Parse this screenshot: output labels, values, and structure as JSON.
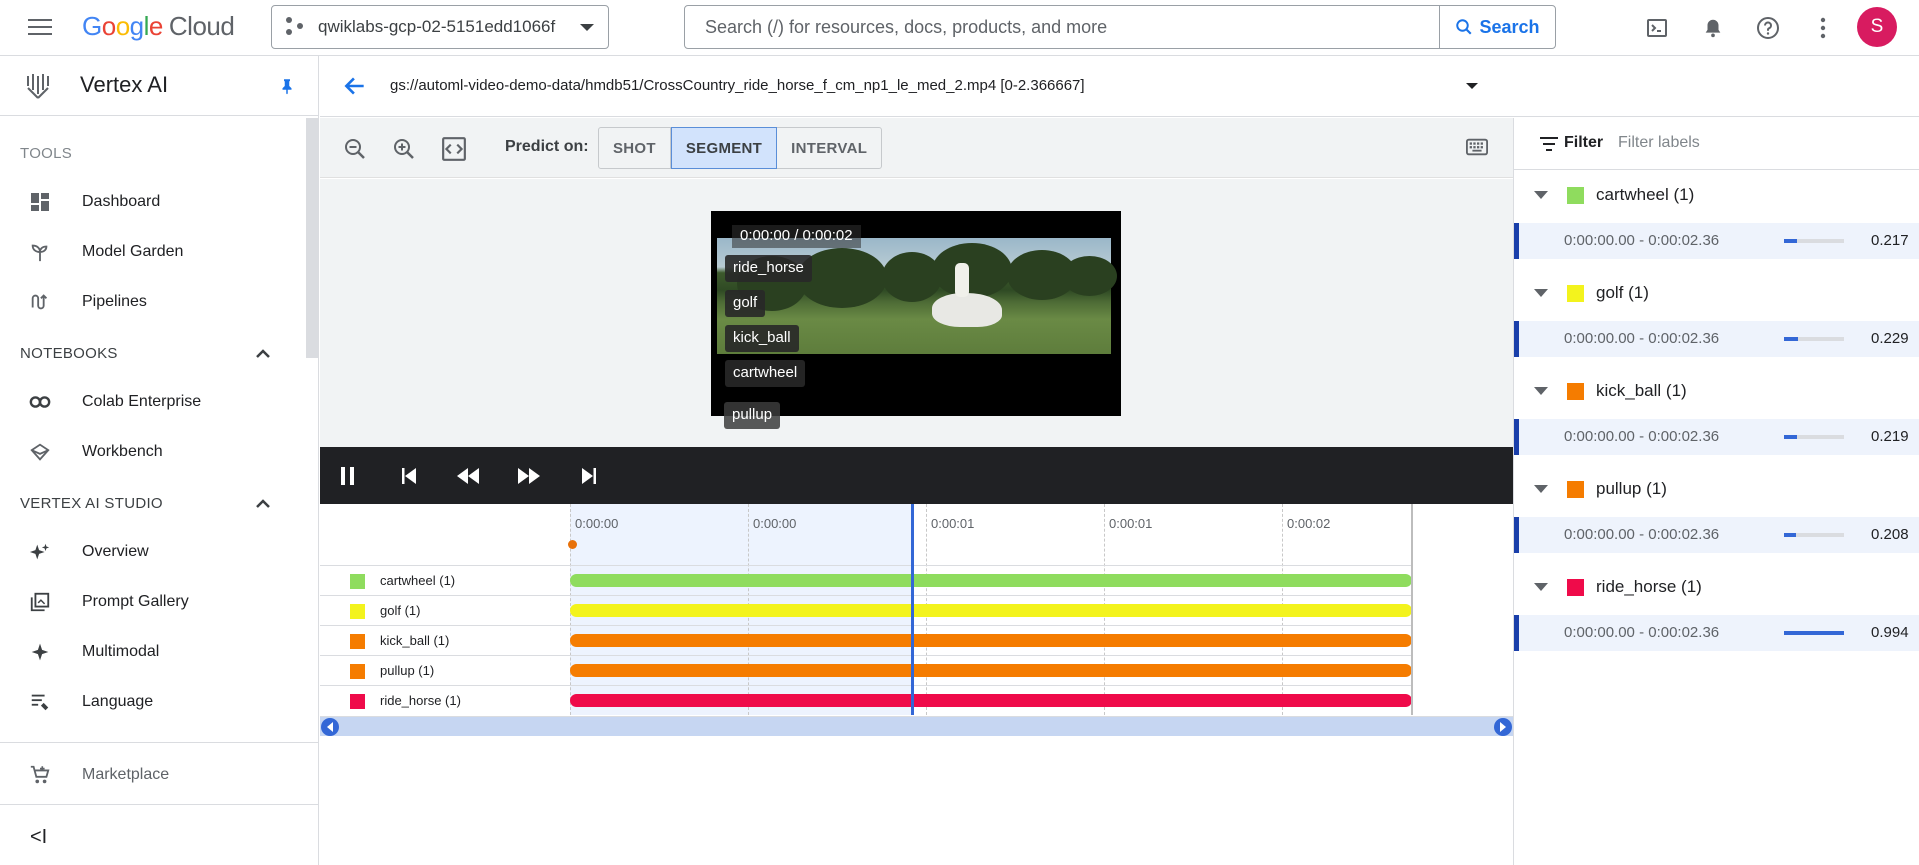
{
  "topbar": {
    "logo_letters": [
      "G",
      "o",
      "o",
      "g",
      "l",
      "e"
    ],
    "logo_suffix": "Cloud",
    "project": "qwiklabs-gcp-02-5151edd1066f",
    "search_placeholder": "Search (/) for resources, docs, products, and more",
    "search_button": "Search",
    "avatar_initial": "S"
  },
  "sidebar": {
    "title": "Vertex AI",
    "sections": {
      "tools": "TOOLS",
      "notebooks": "NOTEBOOKS",
      "studio": "VERTEX AI STUDIO"
    },
    "items": [
      {
        "label": "Dashboard",
        "icon": "dashboard-icon"
      },
      {
        "label": "Model Garden",
        "icon": "model-garden-icon"
      },
      {
        "label": "Pipelines",
        "icon": "pipelines-icon"
      },
      {
        "label": "Colab Enterprise",
        "icon": "colab-icon"
      },
      {
        "label": "Workbench",
        "icon": "workbench-icon"
      },
      {
        "label": "Overview",
        "icon": "sparkle-icon"
      },
      {
        "label": "Prompt Gallery",
        "icon": "gallery-icon"
      },
      {
        "label": "Multimodal",
        "icon": "multimodal-icon"
      },
      {
        "label": "Language",
        "icon": "language-icon"
      }
    ],
    "marketplace": "Marketplace",
    "collapse_glyph": "<I"
  },
  "breadcrumb": {
    "path": "gs://automl-video-demo-data/hmdb51/CrossCountry_ride_horse_f_cm_np1_le_med_2.mp4 [0-2.366667]"
  },
  "toolbar": {
    "predict_label": "Predict on:",
    "modes": [
      "SHOT",
      "SEGMENT",
      "INTERVAL"
    ],
    "active_mode": "SEGMENT"
  },
  "video": {
    "time": "0:00:00 / 0:00:02",
    "tags": [
      "ride_horse",
      "golf",
      "kick_ball",
      "cartwheel"
    ],
    "tag_below": "pullup"
  },
  "timeline": {
    "ticks": [
      "0:00:00",
      "0:00:00",
      "0:00:01",
      "0:00:01",
      "0:00:02"
    ],
    "playhead_fraction": 0.405,
    "rows": [
      {
        "label": "cartwheel (1)",
        "color": "#8fdc5e"
      },
      {
        "label": "golf (1)",
        "color": "#f3f31d"
      },
      {
        "label": "kick_ball (1)",
        "color": "#f57c00"
      },
      {
        "label": "pullup (1)",
        "color": "#f57c00"
      },
      {
        "label": "ride_horse (1)",
        "color": "#ef0b4a"
      }
    ]
  },
  "filter": {
    "label": "Filter",
    "placeholder": "Filter labels"
  },
  "labels": [
    {
      "name": "cartwheel (1)",
      "color": "#8fdc5e",
      "range": "0:00:00.00 - 0:00:02.36",
      "score": "0.217",
      "score_value": 0.217
    },
    {
      "name": "golf (1)",
      "color": "#f3f31d",
      "range": "0:00:00.00 - 0:00:02.36",
      "score": "0.229",
      "score_value": 0.229
    },
    {
      "name": "kick_ball (1)",
      "color": "#f57c00",
      "range": "0:00:00.00 - 0:00:02.36",
      "score": "0.219",
      "score_value": 0.219
    },
    {
      "name": "pullup (1)",
      "color": "#f57c00",
      "range": "0:00:00.00 - 0:00:02.36",
      "score": "0.208",
      "score_value": 0.208
    },
    {
      "name": "ride_horse (1)",
      "color": "#ef0b4a",
      "range": "0:00:00.00 - 0:00:02.36",
      "score": "0.994",
      "score_value": 0.994
    }
  ]
}
